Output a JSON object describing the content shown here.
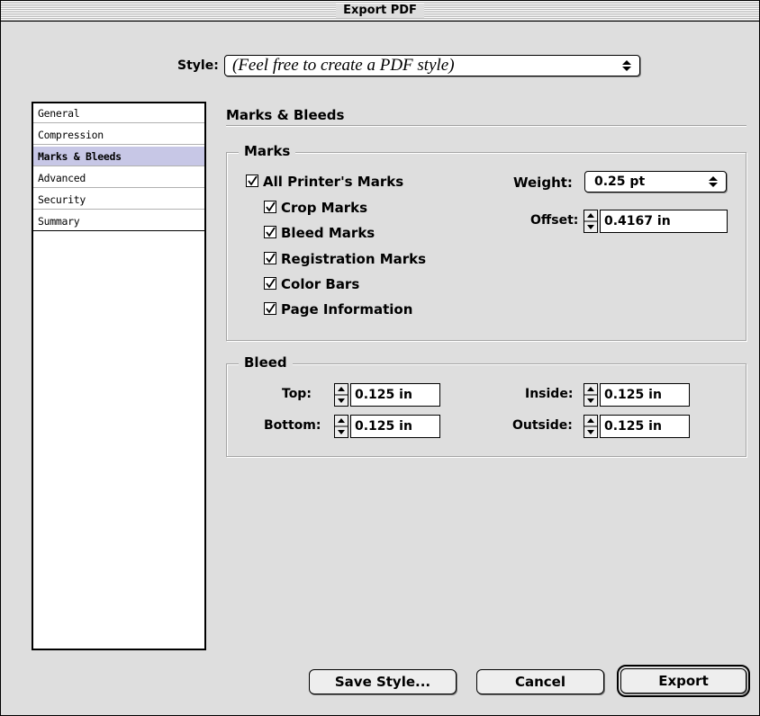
{
  "window": {
    "title": "Export PDF"
  },
  "style": {
    "label": "Style:",
    "value": "(Feel free to create a PDF style)"
  },
  "sidebar": {
    "items": [
      {
        "label": "General"
      },
      {
        "label": "Compression"
      },
      {
        "label": "Marks & Bleeds",
        "selected": true
      },
      {
        "label": "Advanced"
      },
      {
        "label": "Security"
      },
      {
        "label": "Summary"
      }
    ]
  },
  "section": {
    "title": "Marks & Bleeds"
  },
  "marks": {
    "group_label": "Marks",
    "all_printers_marks": {
      "label": "All Printer's Marks",
      "checked": true
    },
    "items": [
      {
        "label": "Crop Marks",
        "checked": true
      },
      {
        "label": "Bleed Marks",
        "checked": true
      },
      {
        "label": "Registration Marks",
        "checked": true
      },
      {
        "label": "Color Bars",
        "checked": true
      },
      {
        "label": "Page Information",
        "checked": true
      }
    ],
    "weight": {
      "label": "Weight:",
      "value": "0.25 pt"
    },
    "offset": {
      "label": "Offset:",
      "value": "0.4167 in"
    }
  },
  "bleed": {
    "group_label": "Bleed",
    "top": {
      "label": "Top:",
      "value": "0.125 in"
    },
    "bottom": {
      "label": "Bottom:",
      "value": "0.125 in"
    },
    "inside": {
      "label": "Inside:",
      "value": "0.125 in"
    },
    "outside": {
      "label": "Outside:",
      "value": "0.125 in"
    }
  },
  "buttons": {
    "save_style": "Save Style...",
    "cancel": "Cancel",
    "export": "Export"
  },
  "icons": {
    "popup_arrows": "up-down-arrows-icon",
    "stepper": "stepper-icon",
    "checkbox": "checkmark-icon"
  }
}
